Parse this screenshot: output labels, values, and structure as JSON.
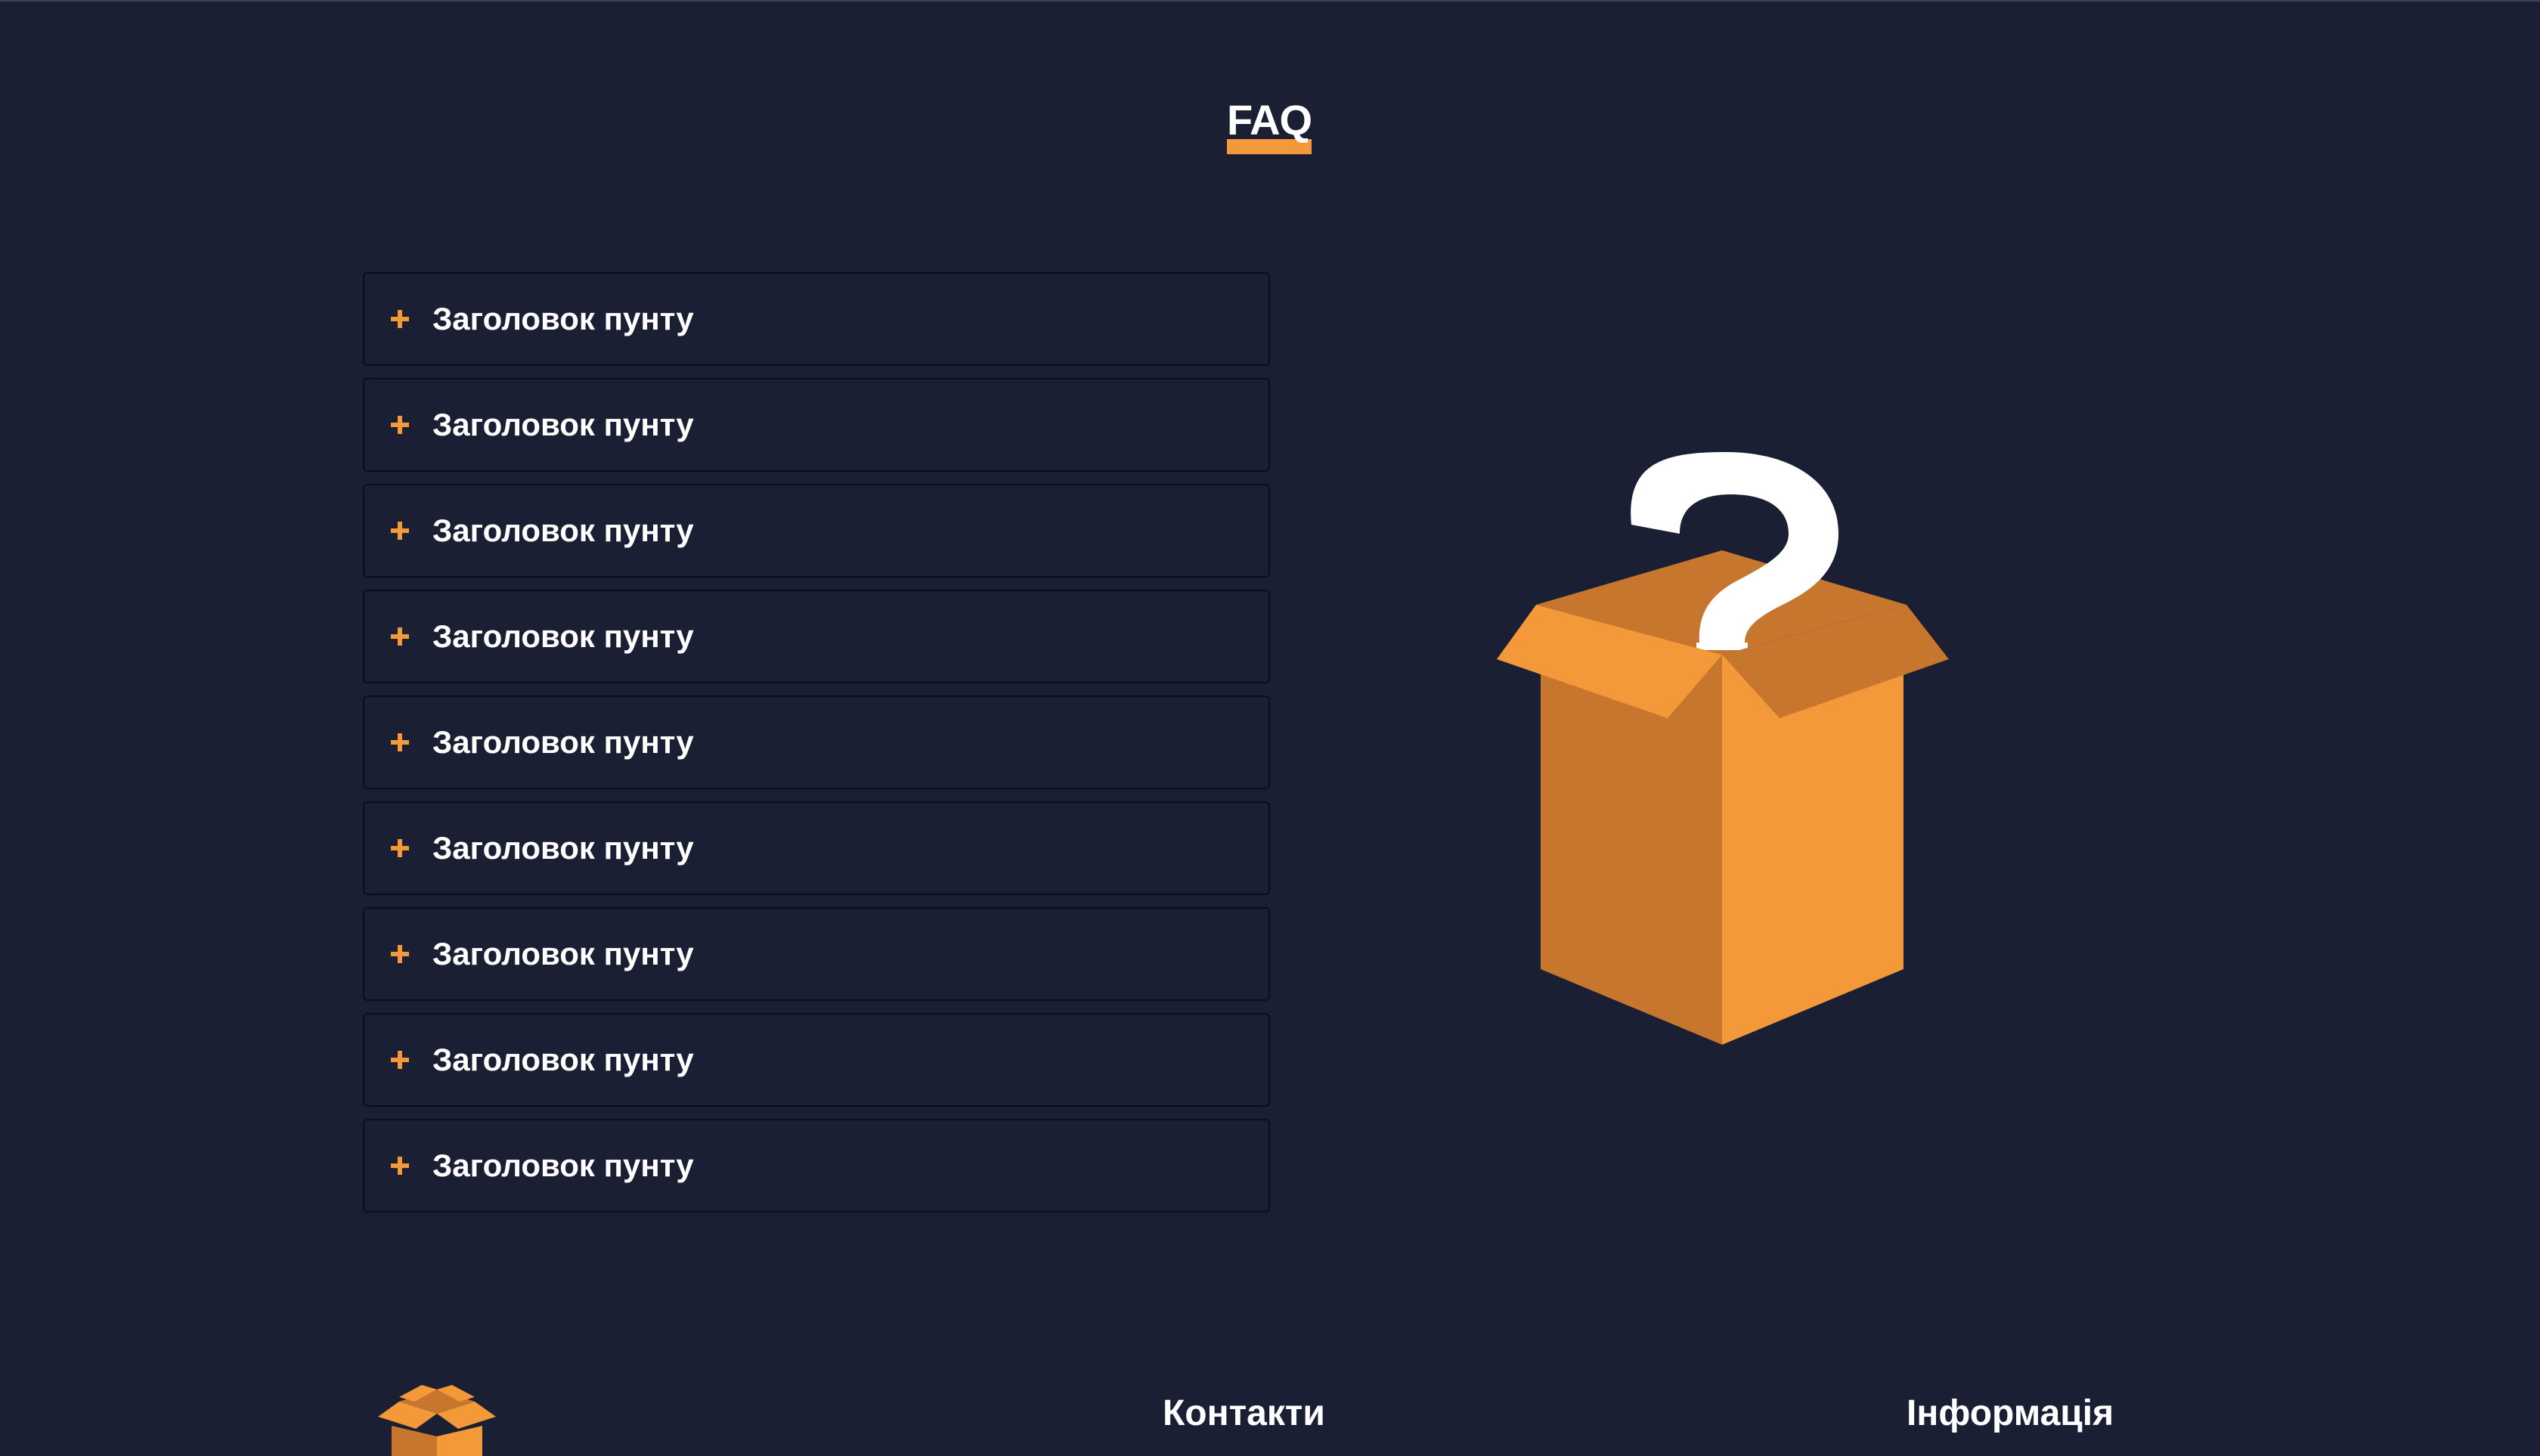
{
  "colors": {
    "background": "#1b1f33",
    "accent": "#f4993a",
    "accent_dark": "#c6762d",
    "text": "#ffffff",
    "item_border": "#0b0d17"
  },
  "faq": {
    "title": "FAQ",
    "items": [
      {
        "label": "Заголовок пунту",
        "icon": "plus-icon"
      },
      {
        "label": "Заголовок пунту",
        "icon": "plus-icon"
      },
      {
        "label": "Заголовок пунту",
        "icon": "plus-icon"
      },
      {
        "label": "Заголовок пунту",
        "icon": "plus-icon"
      },
      {
        "label": "Заголовок пунту",
        "icon": "plus-icon"
      },
      {
        "label": "Заголовок пунту",
        "icon": "plus-icon"
      },
      {
        "label": "Заголовок пунту",
        "icon": "plus-icon"
      },
      {
        "label": "Заголовок пунту",
        "icon": "plus-icon"
      },
      {
        "label": "Заголовок пунту",
        "icon": "plus-icon"
      }
    ]
  },
  "illustration": {
    "icon": "question-box-icon"
  },
  "footer": {
    "logo_icon": "box-logo-icon",
    "contacts_heading": "Контакти",
    "info_heading": "Інформація"
  }
}
